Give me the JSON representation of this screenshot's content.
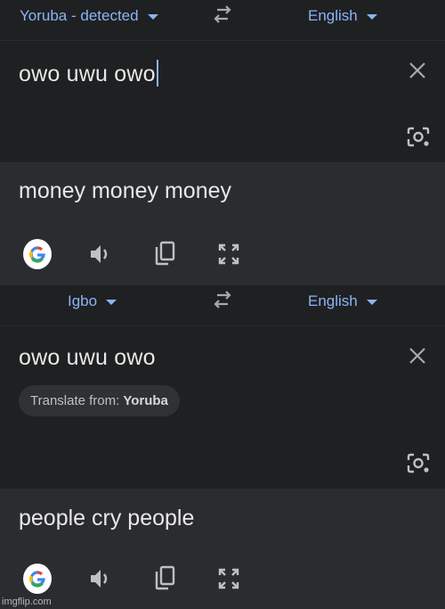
{
  "top": {
    "source_language": "Yoruba - detected",
    "target_language": "English",
    "source_text": "owo uwu owo",
    "translation": "money money money"
  },
  "bottom": {
    "source_language": "Igbo",
    "target_language": "English",
    "source_text": "owo uwu owo",
    "suggestion_prefix": "Translate from:",
    "suggestion_language": "Yoruba",
    "translation": "people cry people"
  },
  "icons": {
    "swap": "swap-horiz-icon",
    "close": "close-icon",
    "camera": "camera-lens-icon",
    "google": "google-g-icon",
    "speaker": "volume-icon",
    "copy": "copy-icon",
    "expand": "fullscreen-icon"
  },
  "colors": {
    "accent": "#8ab4f8",
    "background": "#1f2021",
    "output_background": "#2b2c2f",
    "text": "#e8e8e8"
  },
  "watermark": "imgflip.com"
}
